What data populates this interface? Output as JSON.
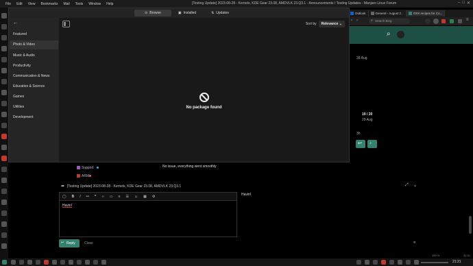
{
  "menubar": {
    "items": [
      "File",
      "Edit",
      "View",
      "Bookmarks",
      "Mail",
      "Tools",
      "Window",
      "Help"
    ],
    "window_title": "[Testing Update] 2023-08-28 - Kernels, KDE Gear 23.08, AMDVLK 23.Q3.1 - Announcements / Testing Updates - Manjaro Linux Forum"
  },
  "discover": {
    "tabs": {
      "browse": "Browse",
      "installed": "Installed",
      "updates": "Updates"
    },
    "sidebar": [
      "Featured",
      "Photo & Video",
      "Music & Audio",
      "Productivity",
      "Communication & News",
      "Education & Science",
      "Games",
      "Utilities",
      "Development"
    ],
    "sort_label": "Sort by",
    "sort_value": "Relevance",
    "empty_message": "No package found"
  },
  "browser": {
    "tabs": [
      "Outlook",
      "General - August 2...",
      "OSX recipes for Co..."
    ],
    "search_placeholder": "Search Bing"
  },
  "forum": {
    "date1": "28 Aug",
    "progress": "19 / 20",
    "date2": "29 Aug",
    "ago": "3h",
    "cat_support": "Support",
    "cat_arm": "ARM",
    "post_text": "No issue, everything went smoothly",
    "reply_topic": "[Testing Update] 2023-08-28 - Kernels, KDE Gear 23.08, AMDVLK 23.Q3.1",
    "editor_text": "Havin!",
    "preview_text": "Havin!",
    "reply_button": "Reply",
    "close_button": "Close"
  },
  "taskbar": {
    "time": "21:21",
    "zoom": "100 %",
    "date_small": "31:31"
  },
  "colors": {
    "accent_green": "#35816f",
    "forum_header": "#1d4f45",
    "menubar": "#1b1b1b"
  }
}
